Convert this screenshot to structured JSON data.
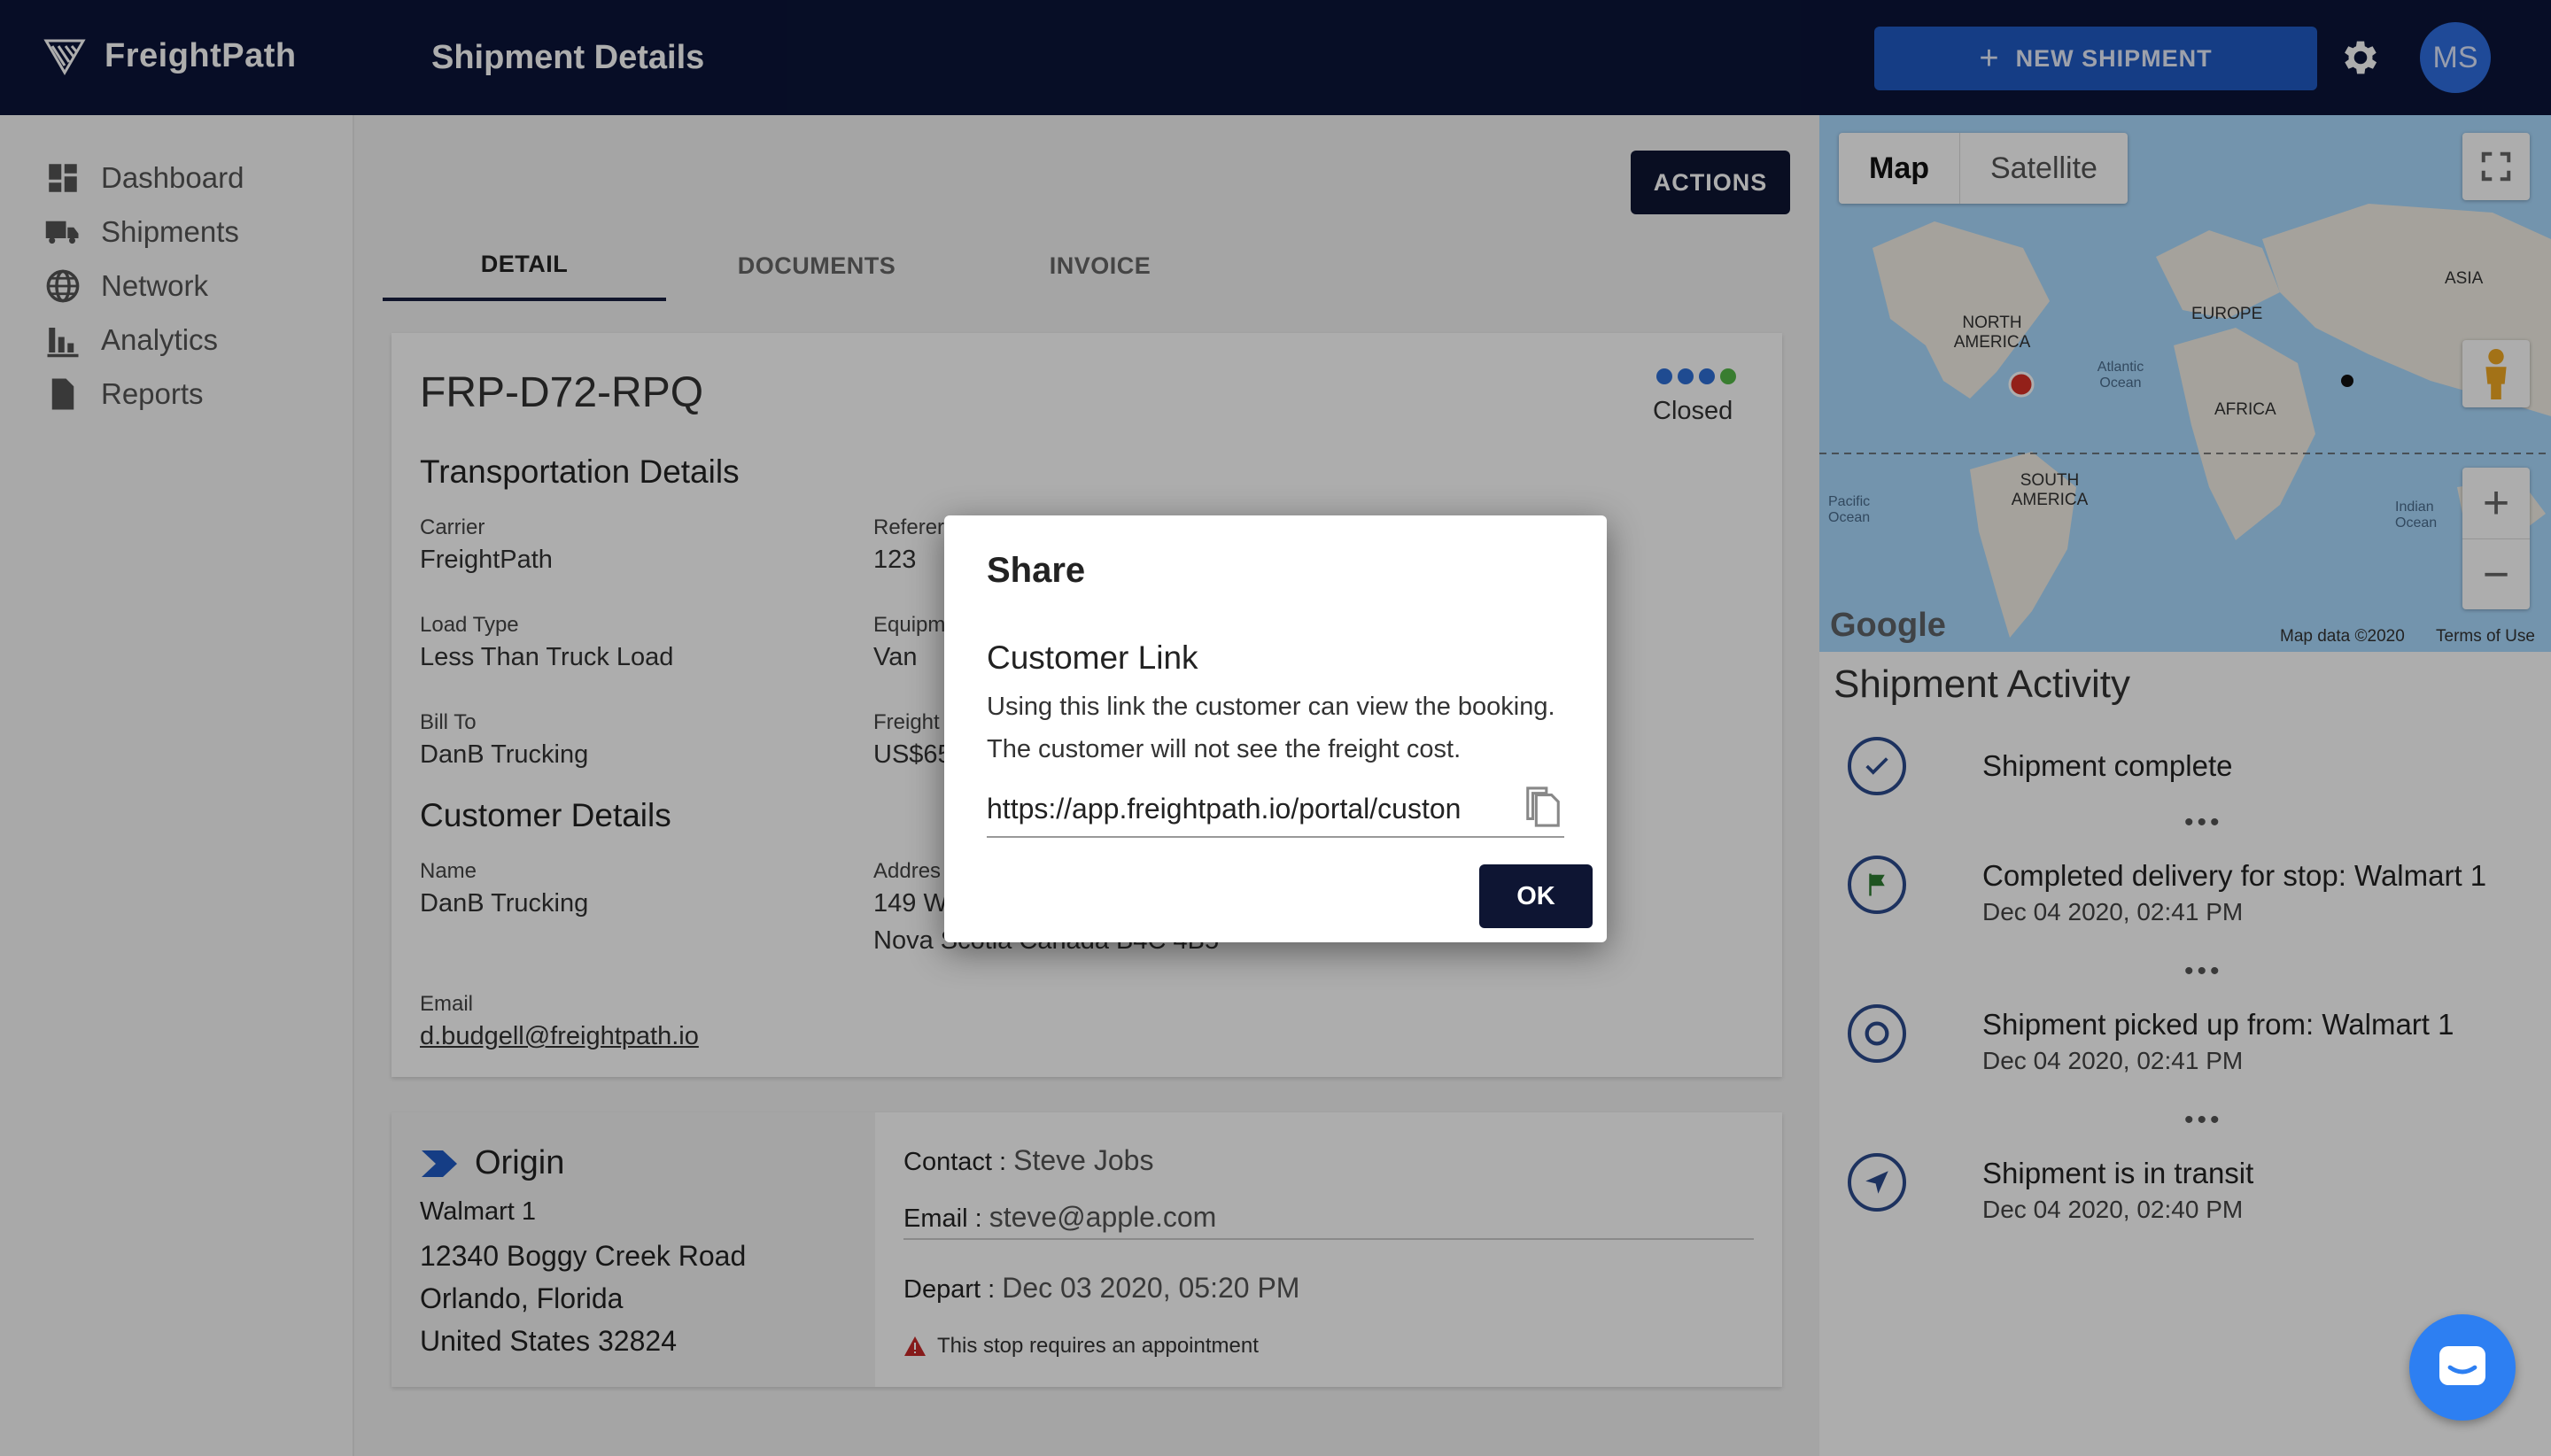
{
  "app": {
    "brand": "FreightPath",
    "page_title": "Shipment Details"
  },
  "topbar": {
    "new_shipment_label": "NEW SHIPMENT",
    "avatar_initials": "MS"
  },
  "sidebar": {
    "items": [
      {
        "label": "Dashboard",
        "icon": "dashboard-icon"
      },
      {
        "label": "Shipments",
        "icon": "truck-icon"
      },
      {
        "label": "Network",
        "icon": "globe-icon"
      },
      {
        "label": "Analytics",
        "icon": "bar-chart-icon"
      },
      {
        "label": "Reports",
        "icon": "document-icon"
      }
    ]
  },
  "main": {
    "actions_label": "ACTIONS",
    "tabs": [
      {
        "label": "DETAIL"
      },
      {
        "label": "DOCUMENTS"
      },
      {
        "label": "INVOICE"
      }
    ],
    "active_tab": "DETAIL",
    "shipment": {
      "id": "FRP-D72-RPQ",
      "status": "Closed",
      "status_dot_colors": [
        "#2f6fd6",
        "#2f6fd6",
        "#2f6fd6",
        "#55b948"
      ],
      "transport_title": "Transportation Details",
      "carrier_label": "Carrier",
      "carrier": "FreightPath",
      "reference_label": "Referer",
      "reference": "123",
      "load_type_label": "Load Type",
      "load_type": "Less Than Truck Load",
      "equipment_label": "Equipm",
      "equipment": "Van",
      "bill_to_label": "Bill To",
      "bill_to": "DanB Trucking",
      "freight_label": "Freight",
      "freight": "US$65",
      "customer_title": "Customer Details",
      "name_label": "Name",
      "name": "DanB Trucking",
      "address_label": "Addres",
      "address_1": "149 W",
      "address_2": "Nova Scotia Canada B4C 4B5",
      "email_label": "Email",
      "email": "d.budgell@freightpath.io"
    },
    "origin": {
      "title": "Origin",
      "name": "Walmart 1",
      "street": "12340 Boggy Creek Road",
      "city": "Orlando, Florida",
      "country": "United States 32824",
      "contact_label": "Contact :",
      "contact": "Steve Jobs",
      "email_label": "Email :",
      "email": "steve@apple.com",
      "depart_label": "Depart :",
      "depart": "Dec 03 2020, 05:20 PM",
      "warning": "This stop requires an appointment"
    }
  },
  "map": {
    "toggle": [
      "Map",
      "Satellite"
    ],
    "active": "Map",
    "labels": [
      "NORTH AMERICA",
      "EUROPE",
      "ASIA",
      "AFRICA",
      "SOUTH AMERICA",
      "Atlantic Ocean",
      "Pacific Ocean",
      "Indian Ocean"
    ],
    "data_credit": "Map data ©2020",
    "terms": "Terms of Use",
    "google": "Google"
  },
  "activity": {
    "title": "Shipment Activity",
    "items": [
      {
        "text": "Shipment complete",
        "date": "",
        "icon": "check-circle-icon"
      },
      {
        "text": "Completed delivery for stop: Walmart 1",
        "date": "Dec 04 2020, 02:41 PM",
        "icon": "flag-icon"
      },
      {
        "text": "Shipment picked up from: Walmart 1",
        "date": "Dec 04 2020, 02:41 PM",
        "icon": "target-icon"
      },
      {
        "text": "Shipment is in transit",
        "date": "Dec 04 2020, 02:40 PM",
        "icon": "navigation-arrow-icon"
      }
    ]
  },
  "modal": {
    "title": "Share",
    "subtitle": "Customer Link",
    "desc_1": "Using this link the customer can view the booking.",
    "desc_2": "The customer will not see the freight cost.",
    "link_value": "https://app.freightpath.io/portal/custon",
    "ok_label": "OK"
  },
  "colors": {
    "topbar": "#0b1438",
    "accent": "#1f5bc4",
    "dark_button": "#0e1533",
    "chat": "#2d7ff2"
  }
}
